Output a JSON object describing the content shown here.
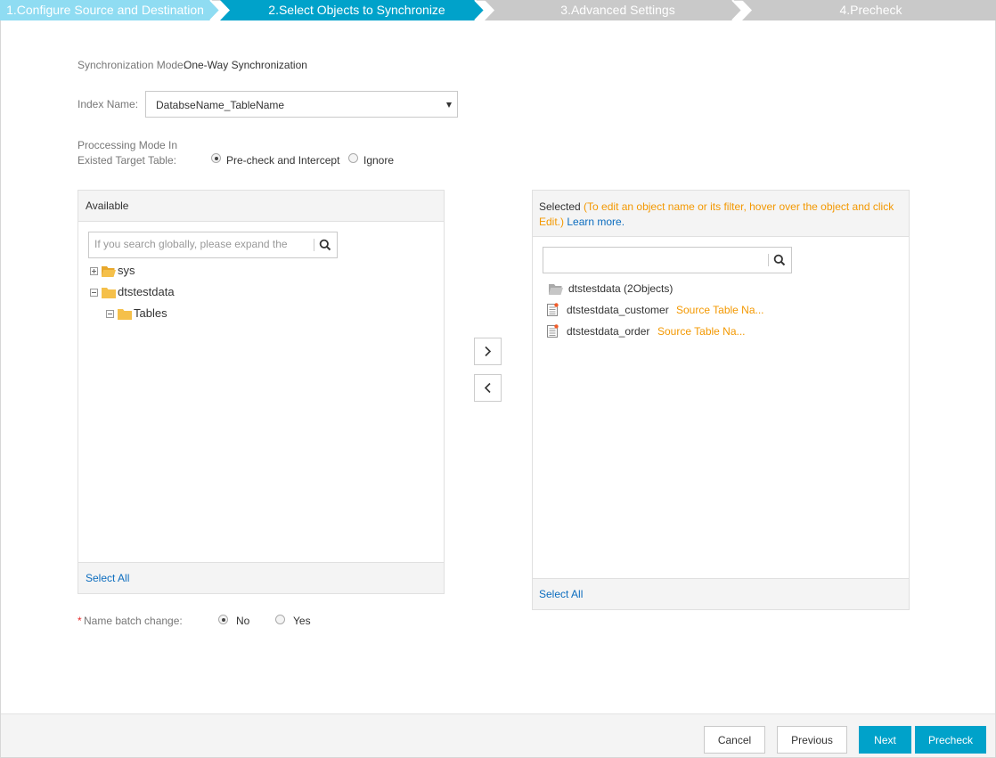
{
  "steps": [
    {
      "label": "1.Configure Source and Destination",
      "state": "done"
    },
    {
      "label": "2.Select Objects to Synchronize",
      "state": "active"
    },
    {
      "label": "3.Advanced Settings",
      "state": "todo"
    },
    {
      "label": "4.Precheck",
      "state": "todo"
    }
  ],
  "sync_mode": {
    "label": "Synchronization Mode:",
    "value": "One-Way Synchronization"
  },
  "index_name": {
    "label": "Index Name:",
    "value": "DatabseName_TableName"
  },
  "processing_mode": {
    "label_line1": "Proccessing Mode In",
    "label_line2": "Existed Target Table:",
    "options": [
      "Pre-check and Intercept",
      "Ignore"
    ],
    "selected": "Pre-check and Intercept"
  },
  "available": {
    "title": "Available",
    "search_placeholder": "If you search globally, please expand the tree",
    "tree": {
      "sys": "sys",
      "db": "dtstestdata",
      "tables": "Tables"
    },
    "select_all": "Select All"
  },
  "selected": {
    "title": "Selected",
    "hint": "(To edit an object name or its filter, hover over the object and click Edit.)",
    "learn_more": "Learn more.",
    "search_value": "",
    "group": "dtstestdata (2Objects)",
    "items": [
      {
        "name": "dtstestdata_customer",
        "tag": "Source Table Na..."
      },
      {
        "name": "dtstestdata_order",
        "tag": "Source Table Na..."
      }
    ],
    "select_all": "Select All"
  },
  "name_batch": {
    "required_mark": "*",
    "label": "Name batch change:",
    "options": [
      "No",
      "Yes"
    ],
    "selected": "No"
  },
  "footer": {
    "cancel": "Cancel",
    "previous": "Previous",
    "next": "Next",
    "precheck": "Precheck"
  },
  "colors": {
    "step_done": "#8fdcf2",
    "step_active": "#00a2ca",
    "step_todo": "#c9c9c9",
    "primary": "#00a2ca",
    "link": "#0c6dbf",
    "hint": "#f39800",
    "folder": "#f5c04a"
  }
}
